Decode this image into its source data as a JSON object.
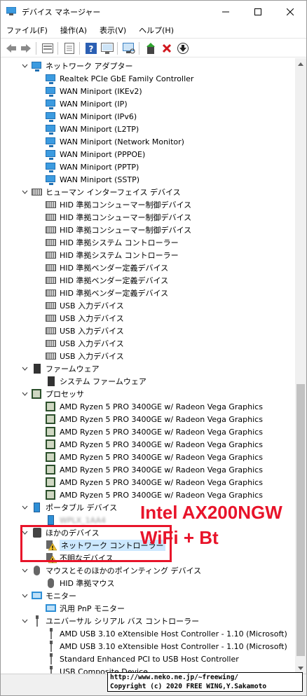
{
  "window": {
    "title": "デバイス マネージャー"
  },
  "menubar": [
    "ファイル(F)",
    "操作(A)",
    "表示(V)",
    "ヘルプ(H)"
  ],
  "toolbar": {
    "icons": [
      "back-icon",
      "forward-icon",
      "properties-icon",
      "update-view-icon",
      "help-icon",
      "show-hidden-icon",
      "scan-hardware-icon",
      "update-driver-icon",
      "uninstall-icon",
      "download-icon"
    ]
  },
  "tree": {
    "network": {
      "label": "ネットワーク アダプター",
      "items": [
        "Realtek PCIe GbE Family Controller",
        "WAN Miniport (IKEv2)",
        "WAN Miniport (IP)",
        "WAN Miniport (IPv6)",
        "WAN Miniport (L2TP)",
        "WAN Miniport (Network Monitor)",
        "WAN Miniport (PPPOE)",
        "WAN Miniport (PPTP)",
        "WAN Miniport (SSTP)"
      ]
    },
    "hid": {
      "label": "ヒューマン インターフェイス デバイス",
      "items": [
        "HID 準拠コンシューマー制御デバイス",
        "HID 準拠コンシューマー制御デバイス",
        "HID 準拠コンシューマー制御デバイス",
        "HID 準拠システム コントローラー",
        "HID 準拠システム コントローラー",
        "HID 準拠ベンダー定義デバイス",
        "HID 準拠ベンダー定義デバイス",
        "HID 準拠ベンダー定義デバイス",
        "USB 入力デバイス",
        "USB 入力デバイス",
        "USB 入力デバイス",
        "USB 入力デバイス",
        "USB 入力デバイス"
      ]
    },
    "firmware": {
      "label": "ファームウェア",
      "items": [
        "システム ファームウェア"
      ]
    },
    "processor": {
      "label": "プロセッサ",
      "items": [
        "AMD Ryzen 5 PRO 3400GE w/ Radeon Vega Graphics",
        "AMD Ryzen 5 PRO 3400GE w/ Radeon Vega Graphics",
        "AMD Ryzen 5 PRO 3400GE w/ Radeon Vega Graphics",
        "AMD Ryzen 5 PRO 3400GE w/ Radeon Vega Graphics",
        "AMD Ryzen 5 PRO 3400GE w/ Radeon Vega Graphics",
        "AMD Ryzen 5 PRO 3400GE w/ Radeon Vega Graphics",
        "AMD Ryzen 5 PRO 3400GE w/ Radeon Vega Graphics",
        "AMD Ryzen 5 PRO 3400GE w/ Radeon Vega Graphics"
      ]
    },
    "portable": {
      "label": "ポータブル デバイス",
      "items": [
        "WPLX_1AA4"
      ]
    },
    "other": {
      "label": "ほかのデバイス",
      "items": [
        "ネットワーク コントローラー",
        "不明なデバイス"
      ]
    },
    "mouse": {
      "label": "マウスとそのほかのポインティング デバイス",
      "items": [
        "HID 準拠マウス"
      ]
    },
    "monitor": {
      "label": "モニター",
      "items": [
        "汎用 PnP モニター"
      ]
    },
    "usb": {
      "label": "ユニバーサル シリアル バス コントローラー",
      "items": [
        "AMD USB 3.10 eXtensible Host Controller - 1.10 (Microsoft)",
        "AMD USB 3.10 eXtensible Host Controller - 1.10 (Microsoft)",
        "Standard Enhanced PCI to USB Host Controller",
        "USB Composite Device"
      ]
    }
  },
  "annotation": {
    "line1": "Intel AX200NGW",
    "line2": "WiFi + Bt",
    "color": "#e8142a"
  },
  "credit": {
    "line1": "http://www.neko.ne.jp/~freewing/",
    "line2": "Copyright (c) 2020 FREE WING,Y.Sakamoto"
  },
  "colors": {
    "selection": "#cce8ff",
    "network_icon": "#3c9be0",
    "warning": "#f2c12e"
  }
}
